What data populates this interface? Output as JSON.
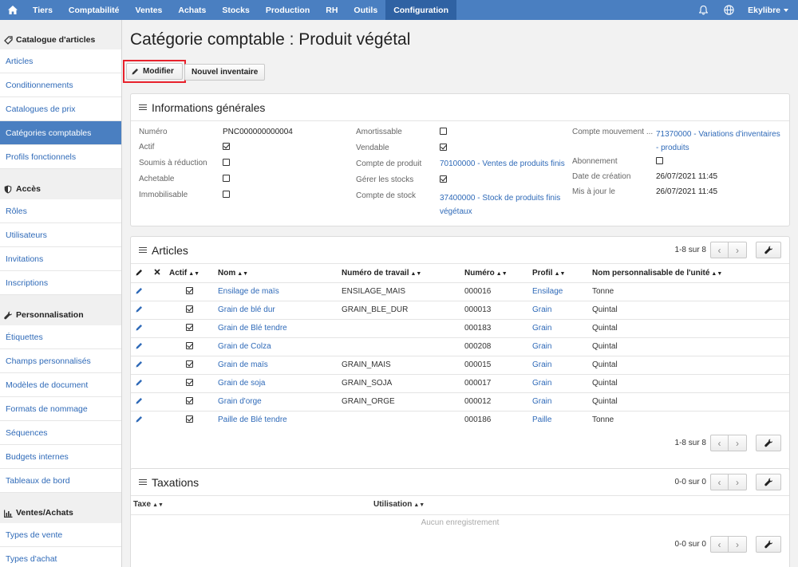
{
  "topnav": {
    "items": [
      "Tiers",
      "Comptabilité",
      "Ventes",
      "Achats",
      "Stocks",
      "Production",
      "RH",
      "Outils",
      "Configuration"
    ],
    "user": "Ekylibre"
  },
  "sidebar": {
    "sections": [
      {
        "title": "Catalogue d'articles",
        "icon": "tag-icon",
        "items": [
          "Articles",
          "Conditionnements",
          "Catalogues de prix",
          "Catégories comptables",
          "Profils fonctionnels"
        ]
      },
      {
        "title": "Accès",
        "icon": "shield-icon",
        "items": [
          "Rôles",
          "Utilisateurs",
          "Invitations",
          "Inscriptions"
        ]
      },
      {
        "title": "Personnalisation",
        "icon": "wrench-icon",
        "items": [
          "Étiquettes",
          "Champs personnalisés",
          "Modèles de document",
          "Formats de nommage",
          "Séquences",
          "Budgets internes",
          "Tableaux de bord"
        ]
      },
      {
        "title": "Ventes/Achats",
        "icon": "bar-chart-icon",
        "items": [
          "Types de vente",
          "Types d'achat"
        ]
      }
    ],
    "active_item": "Catégories comptables"
  },
  "page": {
    "title": "Catégorie comptable : Produit végétal",
    "modify_label": "Modifier",
    "new_inventory_label": "Nouvel inventaire"
  },
  "general": {
    "title": "Informations générales",
    "numero_label": "Numéro",
    "numero": "PNC000000000004",
    "actif_label": "Actif",
    "soumis_label": "Soumis à réduction",
    "achetable_label": "Achetable",
    "immobilisable_label": "Immobilisable",
    "amortissable_label": "Amortissable",
    "vendable_label": "Vendable",
    "compte_produit_label": "Compte de produit",
    "compte_produit": "70100000 - Ventes de produits finis",
    "gerer_stocks_label": "Gérer les stocks",
    "compte_stock_label": "Compte de stock",
    "compte_stock_1": "37400000 - Stock de produits finis",
    "compte_stock_2": "végétaux",
    "compte_mouvement_label": "Compte mouvement ...",
    "compte_mouvement_1": "71370000 - Variations d'inventaires",
    "compte_mouvement_2": "- produits",
    "abonnement_label": "Abonnement",
    "date_creation_label": "Date de création",
    "date_creation": "26/07/2021 11:45",
    "maj_label": "Mis à jour le",
    "maj": "26/07/2021 11:45"
  },
  "articles": {
    "title": "Articles",
    "count": "1-8 sur 8",
    "columns": [
      "Actif",
      "Nom",
      "Numéro de travail",
      "Numéro",
      "Profil",
      "Nom personnalisable de l'unité"
    ],
    "rows": [
      {
        "nom": "Ensilage de maïs",
        "travail": "ENSILAGE_MAIS",
        "numero": "000016",
        "profil": "Ensilage",
        "unite": "Tonne"
      },
      {
        "nom": "Grain de blé dur",
        "travail": "GRAIN_BLE_DUR",
        "numero": "000013",
        "profil": "Grain",
        "unite": "Quintal"
      },
      {
        "nom": "Grain de Blé tendre",
        "travail": "",
        "numero": "000183",
        "profil": "Grain",
        "unite": "Quintal"
      },
      {
        "nom": "Grain de Colza",
        "travail": "",
        "numero": "000208",
        "profil": "Grain",
        "unite": "Quintal"
      },
      {
        "nom": "Grain de maïs",
        "travail": "GRAIN_MAIS",
        "numero": "000015",
        "profil": "Grain",
        "unite": "Quintal"
      },
      {
        "nom": "Grain de soja",
        "travail": "GRAIN_SOJA",
        "numero": "000017",
        "profil": "Grain",
        "unite": "Quintal"
      },
      {
        "nom": "Grain d'orge",
        "travail": "GRAIN_ORGE",
        "numero": "000012",
        "profil": "Grain",
        "unite": "Quintal"
      },
      {
        "nom": "Paille de Blé tendre",
        "travail": "",
        "numero": "000186",
        "profil": "Paille",
        "unite": "Tonne"
      }
    ]
  },
  "taxations": {
    "title": "Taxations",
    "count": "0-0 sur 0",
    "col_taxe": "Taxe",
    "col_utilisation": "Utilisation",
    "empty": "Aucun enregistrement"
  },
  "colors": {
    "nav": "#4a7fc1",
    "nav_active": "#2f62a3",
    "link": "#2f6ab8",
    "highlight": "#e8222c"
  }
}
